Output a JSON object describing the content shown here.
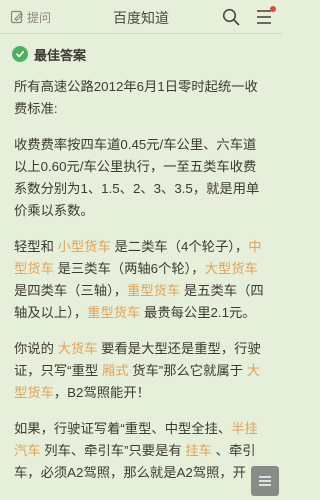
{
  "topbar": {
    "ask_label": "提问",
    "title": "百度知道"
  },
  "answer": {
    "best_label": "最佳答案",
    "paragraphs": [
      [
        {
          "t": "所有高速公路2012年6月1日零时起统一收费标准:"
        }
      ],
      [
        {
          "t": "收费费率按四车道0.45元/车公里、六车道以上0.60元/车公里执行，一至五类车收费系数分别为1、1.5、2、3、3.5，就是用单价乘以系数。"
        }
      ],
      [
        {
          "t": "轻型和 "
        },
        {
          "t": "小型货车",
          "k": true
        },
        {
          "t": " 是二类车（4个轮子），"
        },
        {
          "t": "中型货车",
          "k": true
        },
        {
          "t": " 是三类车（两轴6个轮），"
        },
        {
          "t": "大型货车",
          "k": true
        },
        {
          "t": " 是四类车（三轴），"
        },
        {
          "t": "重型货车",
          "k": true
        },
        {
          "t": " 是五类车（四轴及以上），"
        },
        {
          "t": "重型货车",
          "k": true
        },
        {
          "t": " 最贵每公里2.1元。"
        }
      ],
      [
        {
          "t": "你说的 "
        },
        {
          "t": "大货车",
          "k": true
        },
        {
          "t": " 要看是大型还是重型，行驶证，只写“重型 "
        },
        {
          "t": "厢式",
          "k": true
        },
        {
          "t": " 货车”那么它就属于 "
        },
        {
          "t": "大型货车",
          "k": true
        },
        {
          "t": "，B2驾照能开！"
        }
      ],
      [
        {
          "t": "如果，行驶证写着“重型、中型全挂、"
        },
        {
          "t": "半挂",
          "k": true
        },
        {
          "t": " "
        },
        {
          "t": "汽车",
          "k": true
        },
        {
          "t": " 列车、牵引车”只要是有 "
        },
        {
          "t": "挂车",
          "k": true
        },
        {
          "t": " 、牵引车，必须A2驾照，那么就是A2驾照，开"
        }
      ]
    ]
  },
  "colors": {
    "background": "#e5efd9",
    "keyword": "#e0a45b",
    "badge": "#4bb35f",
    "notify_dot": "#e14b3b"
  },
  "icons": [
    "pencil-icon",
    "search-icon",
    "menu-icon",
    "check-badge-icon",
    "menu-fab-icon"
  ]
}
